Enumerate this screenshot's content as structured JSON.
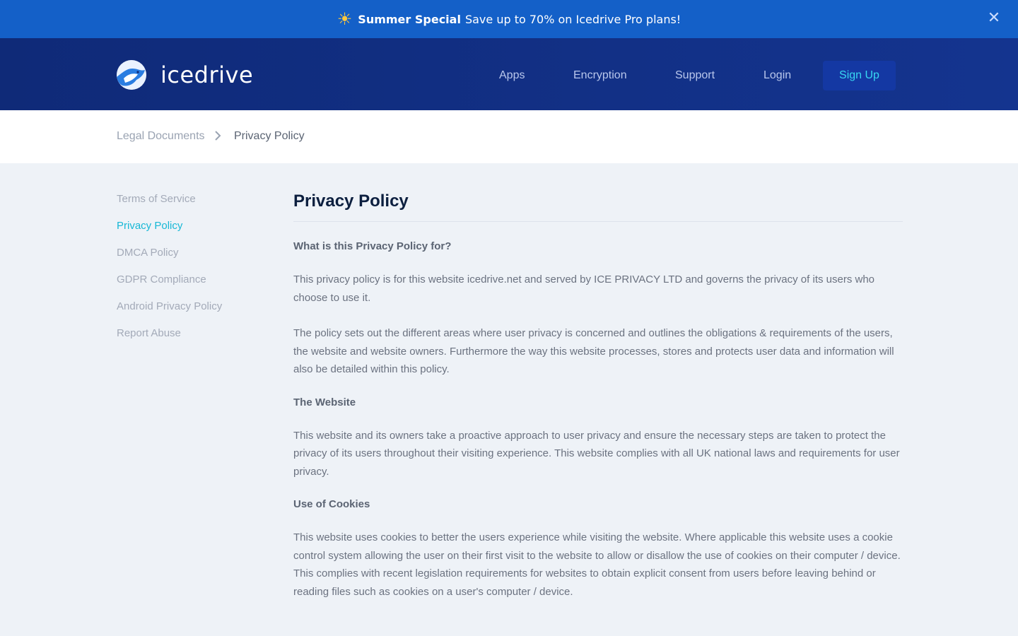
{
  "promo": {
    "icon": "sun-icon",
    "highlight": "Summer Special",
    "text": "Save up to 70% on Icedrive Pro plans!",
    "close_icon": "close-icon"
  },
  "header": {
    "logo_text": "icedrive",
    "nav": [
      "Apps",
      "Encryption",
      "Support",
      "Login"
    ],
    "signup": "Sign Up"
  },
  "breadcrumb": {
    "parent": "Legal Documents",
    "current": "Privacy Policy"
  },
  "sidebar": {
    "items": [
      {
        "label": "Terms of Service",
        "active": false
      },
      {
        "label": "Privacy Policy",
        "active": true
      },
      {
        "label": "DMCA Policy",
        "active": false
      },
      {
        "label": "GDPR Compliance",
        "active": false
      },
      {
        "label": "Android Privacy Policy",
        "active": false
      },
      {
        "label": "Report Abuse",
        "active": false
      }
    ]
  },
  "content": {
    "title": "Privacy Policy",
    "sections": [
      {
        "heading": "What is this Privacy Policy for?"
      },
      {
        "paragraph": "This privacy policy is for this website icedrive.net and served by ICE PRIVACY LTD and governs the privacy of its users who choose to use it."
      },
      {
        "paragraph": "The policy sets out the different areas where user privacy is concerned and outlines the obligations & requirements of the users, the website and website owners. Furthermore the way this website processes, stores and protects user data and information will also be detailed within this policy."
      },
      {
        "heading": "The Website"
      },
      {
        "paragraph": "This website and its owners take a proactive approach to user privacy and ensure the necessary steps are taken to protect the privacy of its users throughout their visiting experience. This website complies with all UK national laws and requirements for user privacy."
      },
      {
        "heading": "Use of Cookies"
      },
      {
        "paragraph": "This website uses cookies to better the users experience while visiting the website. Where applicable this website uses a cookie control system allowing the user on their first visit to the website to allow or disallow the use of cookies on their computer / device. This complies with recent legislation requirements for websites to obtain explicit consent from users before leaving behind or reading files such as cookies on a user's computer / device."
      }
    ]
  },
  "colors": {
    "promo_bg": "#1460c8",
    "header_bg": "#0f2a78",
    "accent": "#17b8d6",
    "signup_text": "#37d7f2",
    "page_bg": "#eef2f7"
  }
}
